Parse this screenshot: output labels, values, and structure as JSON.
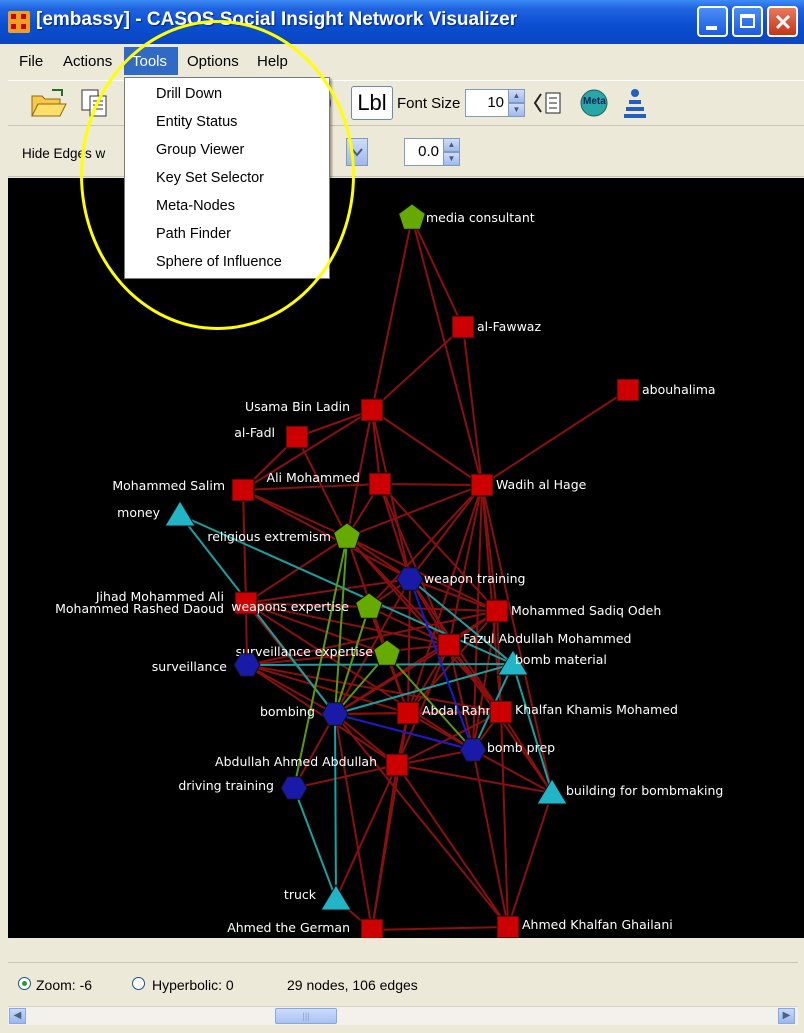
{
  "window": {
    "title": "[embassy] - CASOS Social Insight Network Visualizer",
    "app_icon": "network-app-icon"
  },
  "menubar": {
    "items": [
      "File",
      "Actions",
      "Tools",
      "Options",
      "Help"
    ],
    "active": "Tools"
  },
  "tools_menu": {
    "items": [
      "Drill Down",
      "Entity Status",
      "Group Viewer",
      "Key Set Selector",
      "Meta-Nodes",
      "Path Finder",
      "Sphere of Influence"
    ]
  },
  "toolbar": {
    "lbl_button": "Lbl",
    "font_size_label": "Font Size",
    "font_size_value": "10",
    "meta_button": "Meta",
    "hide_edges_label": "Hide Edges w",
    "threshold_value": "0.0"
  },
  "graph": {
    "colors": {
      "agent": "#cc0000",
      "knowledge": "#1a1aa8",
      "resource": "#22b5c8",
      "belief": "#66aa00",
      "edge": "#8a1010",
      "edge_teal": "#1aa0a0",
      "highlight": "#ffff00"
    },
    "node_labels": {
      "media_consultant": "media consultant",
      "al_fawwaz": "al-Fawwaz",
      "abouhalima": "abouhalima",
      "usama": "Usama Bin Ladin",
      "al_fadl": "al-Fadl",
      "mohammed_salim": "Mohammed Salim",
      "ali_mohammed": "Ali Mohammed",
      "wadih": "Wadih al Hage",
      "money": "money",
      "religious": "religious extremism",
      "weapon_training": "weapon training",
      "jihad": "Jihad Mohammed Ali",
      "rashed": "Mohammed Rashed Daoud",
      "weapons_expertise": "weapons expertise",
      "sadiq": "Mohammed Sadiq Odeh",
      "fazul": "Fazul Abdullah Mohammed",
      "surveillance_expertise": "surveillance expertise",
      "surveillance": "surveillance",
      "bomb_material": "bomb material",
      "bombing": "bombing",
      "abdal": "Abdal Rahman",
      "khalfan": "Khalfan Khamis Mohamed",
      "bomb_prep": "bomb prep",
      "abdullah": "Abdullah Ahmed Abdullah",
      "driving": "driving training",
      "building": "building for bombmaking",
      "truck": "truck",
      "ahmed_german": "Ahmed the German",
      "ghailani": "Ahmed Khalfan Ghailani"
    }
  },
  "status": {
    "zoom": "Zoom: -6",
    "hyperbolic": "Hyperbolic: 0",
    "counts": "29 nodes, 106 edges"
  }
}
